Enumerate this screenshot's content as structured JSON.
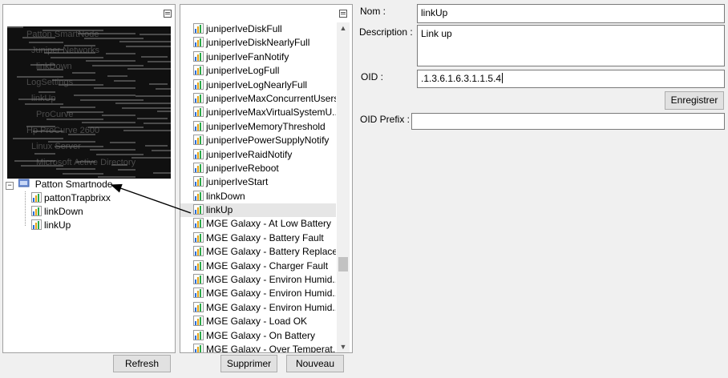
{
  "left_panel": {
    "obscured_items": [
      "Patton SmartNode",
      "Juniper Networks",
      "linkDown",
      "LogSettings",
      "linkUp",
      "ProCurve",
      "Hp ProCurve 2600",
      "Linux Server",
      "Microsoft Active Directory"
    ],
    "tree": {
      "root_label": "Patton Smartnode",
      "children": [
        "pattonTrapbrixx",
        "linkDown",
        "linkUp"
      ]
    },
    "refresh_label": "Refresh"
  },
  "middle_panel": {
    "items": [
      "juniperIveDiskFull",
      "juniperIveDiskNearlyFull",
      "juniperIveFanNotify",
      "juniperIveLogFull",
      "juniperIveLogNearlyFull",
      "juniperIveMaxConcurrentUsers",
      "juniperIveMaxVirtualSystemU...",
      "juniperIveMemoryThreshold",
      "juniperIvePowerSupplyNotify",
      "juniperIveRaidNotify",
      "juniperIveReboot",
      "juniperIveStart",
      "linkDown",
      "linkUp",
      "MGE Galaxy - At Low Battery",
      "MGE Galaxy - Battery Fault",
      "MGE Galaxy - Battery Replace...",
      "MGE Galaxy - Charger Fault",
      "MGE Galaxy - Environ Humid...",
      "MGE Galaxy - Environ Humid...",
      "MGE Galaxy - Environ Humid...",
      "MGE Galaxy - Load OK",
      "MGE Galaxy - On Battery",
      "MGE Galaxy - Over Temperat..."
    ],
    "selected_index": 13,
    "delete_label": "Supprimer",
    "new_label": "Nouveau"
  },
  "form": {
    "name_label": "Nom :",
    "name_value": "linkUp",
    "description_label": "Description :",
    "description_value": "Link up",
    "oid_label": "OID :",
    "oid_value": ".1.3.6.1.6.3.1.1.5.4",
    "save_label": "Enregistrer",
    "oid_prefix_label": "OID Prefix :",
    "oid_prefix_value": ""
  },
  "colors": {
    "selection": "#e6e6e6",
    "panel_border": "#a0a0a0"
  }
}
